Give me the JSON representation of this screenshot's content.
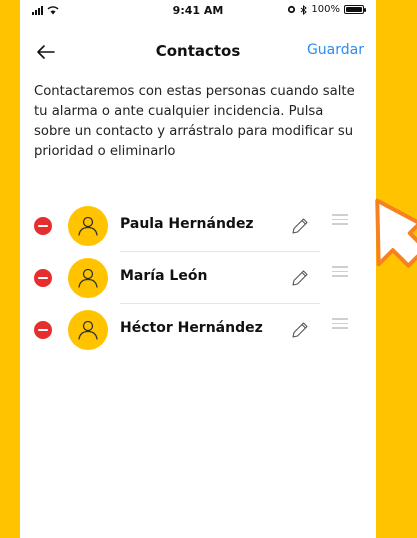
{
  "status": {
    "time": "9:41 AM",
    "battery": "100%"
  },
  "nav": {
    "title": "Contactos",
    "save_label": "Guardar"
  },
  "description": "Contactaremos con estas personas cuando salte tu alarma o ante cualquier incidencia. Pulsa sobre un contacto y arrástralo para modificar su prioridad o eliminarlo",
  "contacts": [
    {
      "name": "Paula Hernández"
    },
    {
      "name": "María León"
    },
    {
      "name": "Héctor Hernández"
    }
  ],
  "colors": {
    "background": "#FFC300",
    "accent": "#2B8CF0",
    "delete": "#E62E2E",
    "annotation": "#F5821F"
  }
}
